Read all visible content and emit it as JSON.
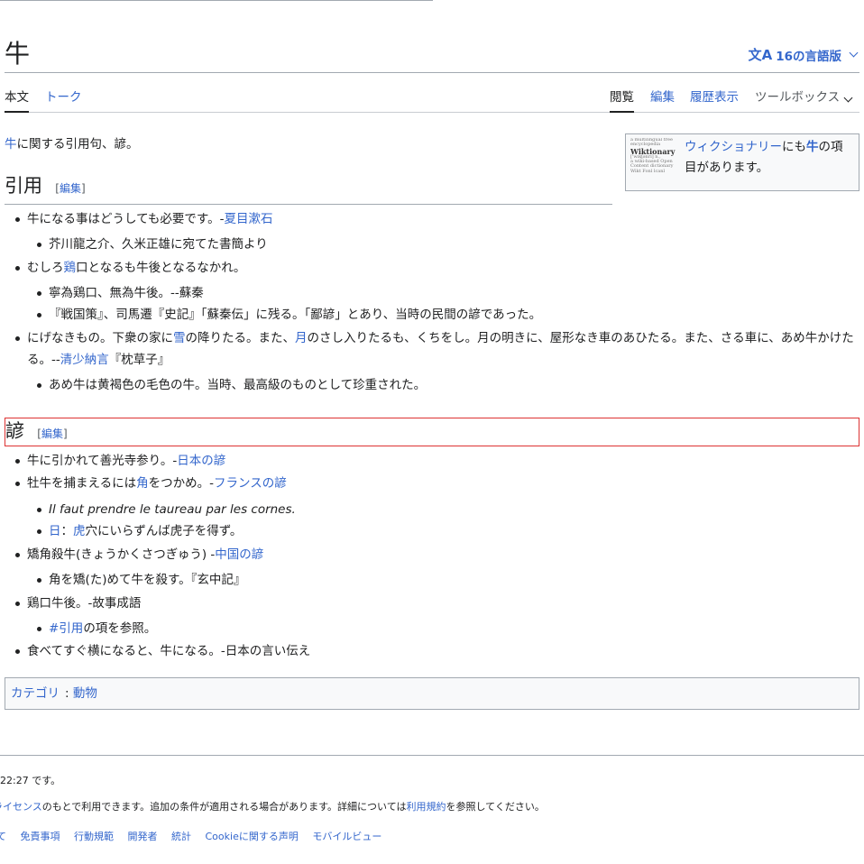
{
  "page": {
    "title": "牛",
    "lang_button": "16の言語版",
    "lang_icon": "文A"
  },
  "tabs": {
    "article": "本文",
    "talk": "トーク",
    "read": "閲覧",
    "edit": "編集",
    "history": "履歴表示",
    "tools": "ツールボックス"
  },
  "intro": {
    "link": "牛",
    "text": "に関する引用句、諺。"
  },
  "wiktionary": {
    "logo_lines": [
      "a multilingual free",
      "encyclopedia",
      "Wiktionary",
      "['wɪkʃənrɪ] n.,",
      "a wiki-based Open",
      "Content dictionary",
      "Wikt Fonl lcanl"
    ],
    "link": "ウィクショナリー",
    "mid": "にも",
    "term": "牛",
    "tail": "の項目があります。"
  },
  "sections": {
    "quotes_heading": "引用",
    "proverbs_heading": "諺",
    "edit_open": "[",
    "edit_label": "編集",
    "edit_close": "]"
  },
  "quotes": [
    {
      "a": "牛になる事はどうしても必要です。-",
      "link": "夏目漱石"
    },
    {
      "text": "芥川龍之介、久米正雄に宛てた書簡より"
    },
    {
      "a": "むしろ",
      "link": "鶏",
      "b": "口となるも牛後となるなかれ。"
    },
    {
      "text": "寧為鶏口、無為牛後。--蘇秦"
    },
    {
      "text": "『戦国策』、司馬遷『史記』「蘇秦伝」に残る。「鄙諺」とあり、当時の民間の諺であった。"
    },
    {
      "a": "にげなきもの。下衆の家に",
      "link1": "雪",
      "b": "の降りたる。また、",
      "link2": "月",
      "c": "のさし入りたるも、くちをし。月の明きに、屋形なき車のあひたる。また、さる車に、あめ牛かけたる。--",
      "link3": "清少納言",
      "d": "『枕草子』"
    },
    {
      "text": "あめ牛は黄褐色の毛色の牛。当時、最高級のものとして珍重された。"
    }
  ],
  "proverbs": [
    {
      "a": "牛に引かれて善光寺参り。-",
      "link": "日本の諺"
    },
    {
      "a": "牡牛を捕まえるには",
      "link1": "角",
      "b": "をつかめ。-",
      "link2": "フランスの諺"
    },
    {
      "text": "Il faut prendre le taureau par les cornes."
    },
    {
      "link1": "日",
      "a": "：",
      "link2": "虎",
      "b": "穴にいらずんば虎子を得ず。"
    },
    {
      "a": "矯角殺牛(きょうかくさつぎゅう) -",
      "link": "中国の諺"
    },
    {
      "text": "角を矯(た)めて牛を殺す。『玄中記』"
    },
    {
      "text": "鶏口牛後。-故事成語"
    },
    {
      "link": "#引用",
      "a": "の項を参照。"
    },
    {
      "text": "食べてすぐ横になると、牛になる。-日本の言い伝え"
    }
  ],
  "category": {
    "label": "カテゴリ",
    "sep": ":",
    "item": "動物"
  },
  "footer": {
    "last_edit": "22:27 です。",
    "license_link": "ライセンス",
    "license_a": "のもとで利用できます。追加の条件が適用される場合があります。詳細については",
    "terms_link": "利用規約",
    "license_b": "を参照してください。",
    "links": [
      "て",
      "免責事項",
      "行動規範",
      "開発者",
      "統計",
      "Cookieに関する声明",
      "モバイルビュー"
    ]
  }
}
